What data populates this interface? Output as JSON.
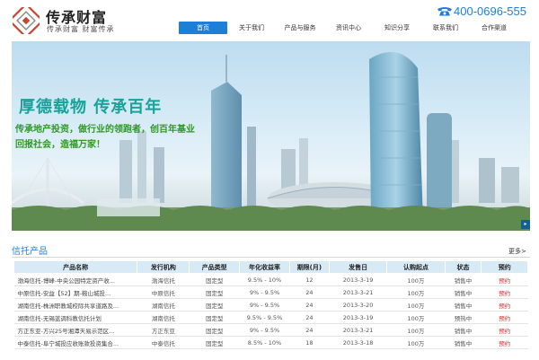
{
  "brand": {
    "title": "传承财富",
    "slogan": "传承财富  财富传承"
  },
  "nav": {
    "items": [
      {
        "label": "首页",
        "active": true
      },
      {
        "label": "关于我们",
        "active": false
      },
      {
        "label": "产品与服务",
        "active": false
      },
      {
        "label": "资讯中心",
        "active": false
      },
      {
        "label": "知识分享",
        "active": false
      },
      {
        "label": "联系我们",
        "active": false
      },
      {
        "label": "合作渠道",
        "active": false
      }
    ]
  },
  "hotline": {
    "number": "400-0696-555",
    "icon": "telephone-icon"
  },
  "banner": {
    "headline": "厚德载物  传承百年",
    "line1": "传承地产投资，做行业的领跑者，创百年基业",
    "line2": "回报社会，造福万家！"
  },
  "section": {
    "title": "信托产品",
    "more": "更多>"
  },
  "table": {
    "headers": [
      "产品名称",
      "发行机构",
      "产品类型",
      "年化收益率",
      "期限(月)",
      "发售日",
      "认购起点",
      "状态",
      "预约"
    ],
    "rows": [
      [
        "渤海信托-博峰-中央公园特定资产收...",
        "渤海信托",
        "固定型",
        "9.5% - 10%",
        "12",
        "2013-3-19",
        "100万",
        "销售中",
        "预约"
      ],
      [
        "中原信托-安益【52】期-鞍山城投...",
        "中原信托",
        "固定型",
        "9% - 9.5%",
        "24",
        "2013-3-21",
        "100万",
        "销售中",
        "预约"
      ],
      [
        "湖南信托-株洲职教城校际共享道路及...",
        "湖南信托",
        "固定型",
        "9% - 9.5%",
        "24",
        "2013-3-20",
        "100万",
        "销售中",
        "预约"
      ],
      [
        "湖南信托-无锡蓝调科教信托计划",
        "湖南信托",
        "固定型",
        "9.5% - 9.5%",
        "24",
        "2013-3-19",
        "100万",
        "预热中",
        "预约"
      ],
      [
        "方正东亚-方兴25号湘潭天易示范区...",
        "方正东亚",
        "固定型",
        "9% - 9.5%",
        "24",
        "2013-3-21",
        "100万",
        "销售中",
        "预约"
      ],
      [
        "中泰信托-阜宁城投应收账款投资集合...",
        "中泰信托",
        "固定型",
        "8.5% - 10%",
        "18",
        "2013-3-18",
        "100万",
        "销售中",
        "预约"
      ]
    ]
  },
  "colors": {
    "accent": "#1e7fd6",
    "headline": "#18a39a",
    "slogan_green": "#2f9a25",
    "reserve_red": "#e02a2a",
    "table_header": "#d8eaf6"
  }
}
